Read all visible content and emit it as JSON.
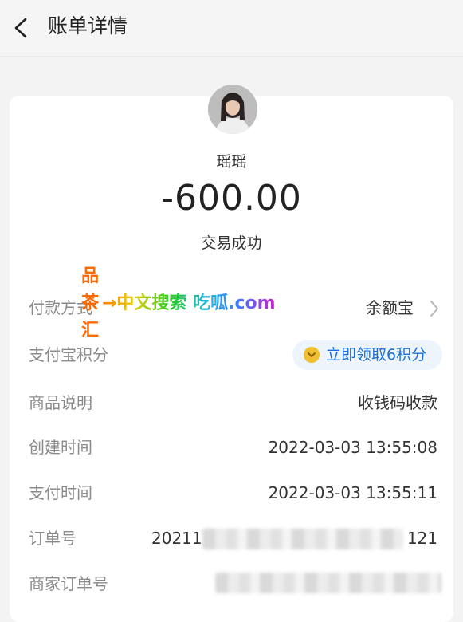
{
  "header": {
    "title": "账单详情",
    "back_icon": "chevron-left-icon"
  },
  "summary": {
    "payee": "瑶瑶",
    "amount": "-600.00",
    "status": "交易成功"
  },
  "rows": {
    "payment_method": {
      "label": "付款方式",
      "value": "余额宝"
    },
    "points": {
      "label": "支付宝积分",
      "action": "立即领取6积分",
      "icon": "coin-icon",
      "coin_color": "#f0c030",
      "action_color": "#1a6fd6"
    },
    "product": {
      "label": "商品说明",
      "value": "收钱码收款"
    },
    "created": {
      "label": "创建时间",
      "value": "2022-03-03 13:55:08"
    },
    "paid": {
      "label": "支付时间",
      "value": "2022-03-03 13:55:11"
    },
    "order_no": {
      "label": "订单号",
      "prefix": "20211",
      "suffix": "121"
    },
    "merchant_order_no": {
      "label": "商家订单号"
    }
  },
  "watermark": {
    "vertical": [
      "品",
      "茶",
      "汇"
    ],
    "line": "→中文搜索 吃呱.com",
    "colors": [
      "#ff6a00",
      "#22cc22",
      "#3a7bff",
      "#cc22cc"
    ]
  }
}
